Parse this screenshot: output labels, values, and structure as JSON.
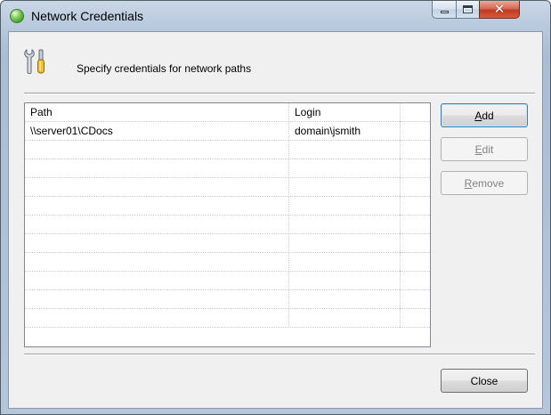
{
  "window": {
    "title": "Network Credentials",
    "icon": "green-orb-icon"
  },
  "header": {
    "icon": "wrench-screwdriver-icon",
    "text": "Specify credentials for network paths"
  },
  "table": {
    "columns": [
      "Path",
      "Login",
      ""
    ],
    "rows": [
      [
        "\\\\server01\\CDocs",
        "domain\\jsmith",
        ""
      ]
    ],
    "empty_row_count": 10
  },
  "buttons": {
    "add": {
      "label": "Add",
      "mnemonic": "A",
      "rest": "dd",
      "enabled": true
    },
    "edit": {
      "label": "Edit",
      "mnemonic": "E",
      "rest": "dit",
      "enabled": false
    },
    "remove": {
      "label": "Remove",
      "mnemonic": "R",
      "rest": "emove",
      "enabled": false
    },
    "close": {
      "label": "Close"
    }
  },
  "colors": {
    "titlebar": "#b8c9dd",
    "client_bg": "#f0f0f0",
    "default_button_border": "#3c7fb1"
  }
}
